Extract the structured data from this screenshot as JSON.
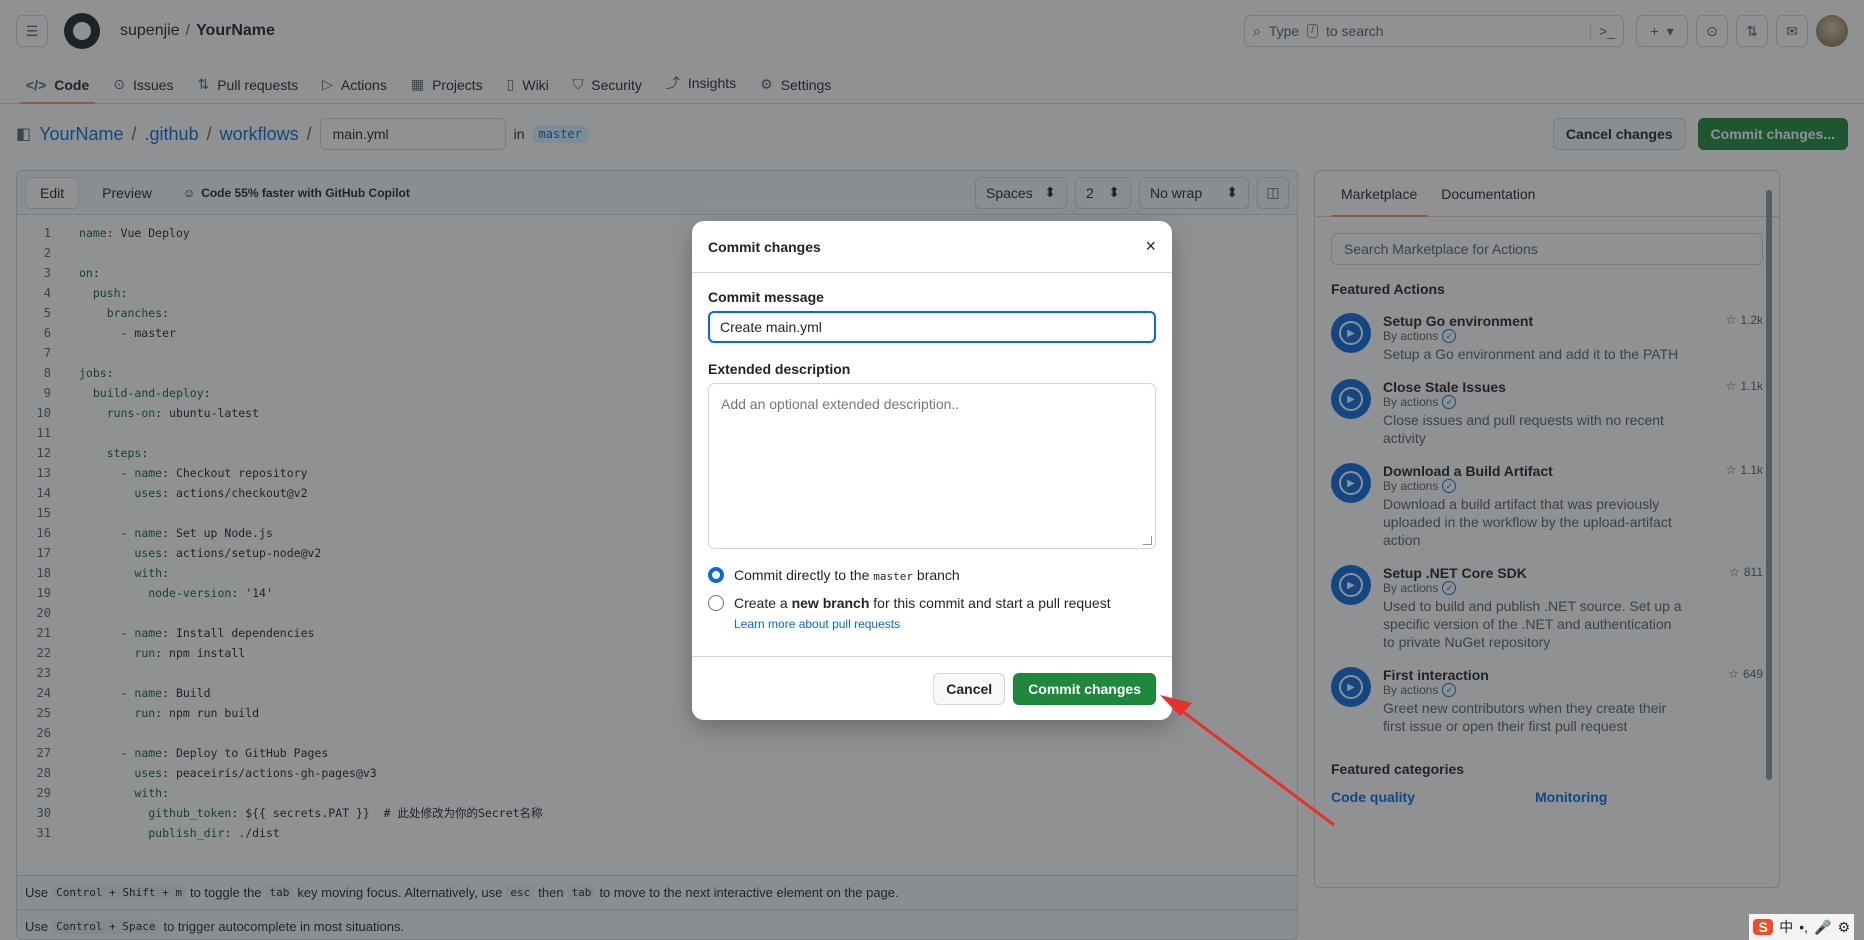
{
  "header": {
    "owner": "supenjie",
    "separator": "/",
    "repo": "YourName",
    "search_prefix": "Type",
    "search_key": "/",
    "search_suffix": "to search",
    "terminal_glyph": ">_",
    "plus_glyph": "+",
    "chevron": "▾"
  },
  "tabs": [
    {
      "label": "Code",
      "icon": "</>"
    },
    {
      "label": "Issues",
      "icon": "⊙"
    },
    {
      "label": "Pull requests",
      "icon": "⇅"
    },
    {
      "label": "Actions",
      "icon": "▷"
    },
    {
      "label": "Projects",
      "icon": "▦"
    },
    {
      "label": "Wiki",
      "icon": "▯"
    },
    {
      "label": "Security",
      "icon": "⛉"
    },
    {
      "label": "Insights",
      "icon": "⤴"
    },
    {
      "label": "Settings",
      "icon": "⚙"
    }
  ],
  "editor_title": {
    "repo": "YourName",
    "dir1": ".github",
    "dir2": "workflows",
    "filename": "main.yml",
    "in_label": "in",
    "branch": "master",
    "cancel_label": "Cancel changes",
    "commit_label": "Commit changes..."
  },
  "toolbar": {
    "edit": "Edit",
    "preview": "Preview",
    "copilot": "Code 55% faster with GitHub Copilot",
    "indent_mode": "Spaces",
    "indent_size": "2",
    "wrap_mode": "No wrap"
  },
  "code_lines": [
    {
      "n": "1",
      "t": "name: Vue Deploy"
    },
    {
      "n": "2",
      "t": ""
    },
    {
      "n": "3",
      "t": "on:"
    },
    {
      "n": "4",
      "t": "  push:"
    },
    {
      "n": "5",
      "t": "    branches:"
    },
    {
      "n": "6",
      "t": "      - master"
    },
    {
      "n": "7",
      "t": ""
    },
    {
      "n": "8",
      "t": "jobs:"
    },
    {
      "n": "9",
      "t": "  build-and-deploy:"
    },
    {
      "n": "10",
      "t": "    runs-on: ubuntu-latest"
    },
    {
      "n": "11",
      "t": ""
    },
    {
      "n": "12",
      "t": "    steps:"
    },
    {
      "n": "13",
      "t": "      - name: Checkout repository"
    },
    {
      "n": "14",
      "t": "        uses: actions/checkout@v2"
    },
    {
      "n": "15",
      "t": ""
    },
    {
      "n": "16",
      "t": "      - name: Set up Node.js"
    },
    {
      "n": "17",
      "t": "        uses: actions/setup-node@v2"
    },
    {
      "n": "18",
      "t": "        with:"
    },
    {
      "n": "19",
      "t": "          node-version: '14'"
    },
    {
      "n": "20",
      "t": ""
    },
    {
      "n": "21",
      "t": "      - name: Install dependencies"
    },
    {
      "n": "22",
      "t": "        run: npm install"
    },
    {
      "n": "23",
      "t": ""
    },
    {
      "n": "24",
      "t": "      - name: Build"
    },
    {
      "n": "25",
      "t": "        run: npm run build"
    },
    {
      "n": "26",
      "t": ""
    },
    {
      "n": "27",
      "t": "      - name: Deploy to GitHub Pages"
    },
    {
      "n": "28",
      "t": "        uses: peaceiris/actions-gh-pages@v3"
    },
    {
      "n": "29",
      "t": "        with:"
    },
    {
      "n": "30",
      "t": "          github_token: ${{ secrets.PAT }}  # 此处修改为你的Secret名称"
    },
    {
      "n": "31",
      "t": "          publish_dir: ./dist"
    }
  ],
  "footer_hints": {
    "hint1_a": "Use",
    "hint1_k1": "Control + Shift + m",
    "hint1_b": "to toggle the",
    "hint1_k2": "tab",
    "hint1_c": "key moving focus. Alternatively, use",
    "hint1_k3": "esc",
    "hint1_d": "then",
    "hint1_k4": "tab",
    "hint1_e": "to move to the next interactive element on the page.",
    "hint2_a": "Use",
    "hint2_k1": "Control + Space",
    "hint2_b": "to trigger autocomplete in most situations."
  },
  "side": {
    "tab_marketplace": "Marketplace",
    "tab_docs": "Documentation",
    "search_placeholder": "Search Marketplace for Actions",
    "featured_title": "Featured Actions",
    "by_label": "By actions",
    "actions": [
      {
        "name": "Setup Go environment",
        "stars": "1.2k",
        "desc": "Setup a Go environment and add it to the PATH"
      },
      {
        "name": "Close Stale Issues",
        "stars": "1.1k",
        "desc": "Close issues and pull requests with no recent activity"
      },
      {
        "name": "Download a Build Artifact",
        "stars": "1.1k",
        "desc": "Download a build artifact that was previously uploaded in the workflow by the upload-artifact action"
      },
      {
        "name": "Setup .NET Core SDK",
        "stars": "811",
        "desc": "Used to build and publish .NET source. Set up a specific version of the .NET and authentication to private NuGet repository"
      },
      {
        "name": "First interaction",
        "stars": "649",
        "desc": "Greet new contributors when they create their first issue or open their first pull request"
      }
    ],
    "categories_title": "Featured categories",
    "cat1": "Code quality",
    "cat2": "Monitoring"
  },
  "dialog": {
    "title": "Commit changes",
    "close": "×",
    "message_label": "Commit message",
    "message_value": "Create main.yml",
    "desc_label": "Extended description",
    "desc_placeholder": "Add an optional extended description..",
    "opt1_a": "Commit directly to the",
    "opt1_branch": "master",
    "opt1_b": "branch",
    "opt2_a": "Create a",
    "opt2_bold": "new branch",
    "opt2_b": "for this commit and start a pull request",
    "learn_more": "Learn more about pull requests",
    "cancel": "Cancel",
    "commit": "Commit changes"
  },
  "ime": {
    "logo": "S",
    "lang": "中",
    "punct": "•,",
    "mic": "🎤",
    "misc": "⚙"
  },
  "colors": {
    "accent": "#0969da",
    "commit_green": "#1f883d",
    "tab_underline": "#fd8c73",
    "arrow": "#e8312b"
  }
}
